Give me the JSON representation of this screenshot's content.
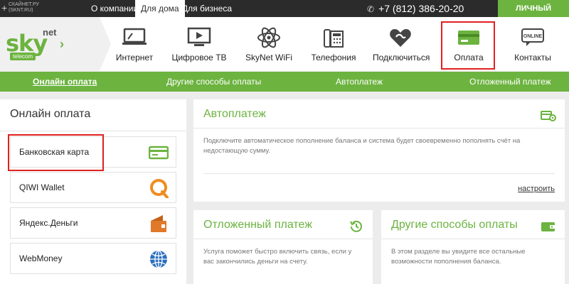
{
  "topbar": {
    "plus": "+",
    "site_line1": "СКАЙНЕТ.РУ",
    "site_line2": "(SKNT.RU)",
    "tabs": [
      "О компании",
      "Для дома",
      "Для бизнеса"
    ],
    "phone": "+7 (812) 386-20-20",
    "cabinet": "ЛИЧНЫЙ КАБИНЕТ"
  },
  "logo": {
    "sky": "sky",
    "net": "net",
    "telecom": "telecom"
  },
  "nav": [
    {
      "label": "Интернет",
      "icon": "monitor-icon"
    },
    {
      "label": "Цифровое ТВ",
      "icon": "tv-icon"
    },
    {
      "label": "SkyNet WiFi",
      "icon": "atom-icon"
    },
    {
      "label": "Телефония",
      "icon": "phone-icon"
    },
    {
      "label": "Подключиться",
      "icon": "connect-heart-icon"
    },
    {
      "label": "Оплата",
      "icon": "card-icon"
    },
    {
      "label": "Контакты",
      "icon": "online-chat-icon"
    }
  ],
  "nav_online_badge": "ONLINE",
  "subnav": [
    "Онлайн оплата",
    "Другие способы оплаты",
    "Автоплатеж",
    "Отложенный платеж"
  ],
  "sidebar": {
    "title": "Онлайн оплата",
    "items": [
      "Банковская карта",
      "QIWI Wallet",
      "Яндекс.Деньги",
      "WebMoney"
    ]
  },
  "cards": {
    "autopay": {
      "title": "Автоплатеж",
      "desc": "Подключите автоматическое пополнение баланса и система будет своевременно пополнять счёт на недостающую сумму.",
      "link": "настроить"
    },
    "deferred": {
      "title": "Отложенный платеж",
      "desc": "Услуга поможет быстро включить связь, если у вас закончились деньги на счету."
    },
    "other": {
      "title": "Другие способы оплаты",
      "desc": "В этом разделе вы увидите все остальные возможности пополнения баланса."
    }
  },
  "colors": {
    "accent": "#6cb33f",
    "topbar": "#2b2b2b",
    "highlight": "#e02020"
  }
}
